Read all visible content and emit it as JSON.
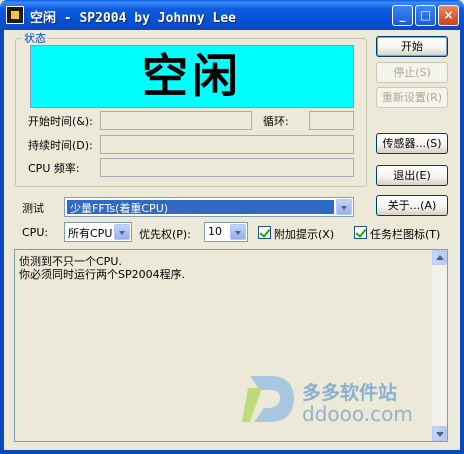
{
  "window": {
    "title": "空闲 - SP2004 by Johnny Lee",
    "minimize": "_",
    "maximize": "□",
    "close": "×"
  },
  "status_group": {
    "legend": "状态",
    "status_text": "空闲",
    "status_color": "#00FFFF",
    "start_time_label": "开始时间(&):",
    "start_time_value": "",
    "loop_label": "循环:",
    "loop_value": "",
    "duration_label": "持续时间(D):",
    "duration_value": "",
    "cpu_freq_label": "CPU 频率:",
    "cpu_freq_value": ""
  },
  "buttons": {
    "start": "开始",
    "stop": "停止(S)",
    "reset": "重新设置(R)",
    "sensors": "传感器...(S)",
    "exit": "退出(E)",
    "about": "关于...(A)"
  },
  "test": {
    "label": "测试",
    "selected": "少量FFTs(着重CPU)"
  },
  "cpu": {
    "label": "CPU:",
    "selected": "所有CPU"
  },
  "priority": {
    "label": "优先权(P):",
    "selected": "10"
  },
  "checkboxes": {
    "extra_hints": {
      "label": "附加提示(X)",
      "checked": true
    },
    "taskbar_icon": {
      "label": "任务栏图标(T)",
      "checked": true
    }
  },
  "log": {
    "lines": [
      "侦测到不只一个CPU.",
      "你必须同时运行两个SP2004程序."
    ]
  },
  "watermark": {
    "name": "多多软件站",
    "url": "ddooo.com"
  }
}
